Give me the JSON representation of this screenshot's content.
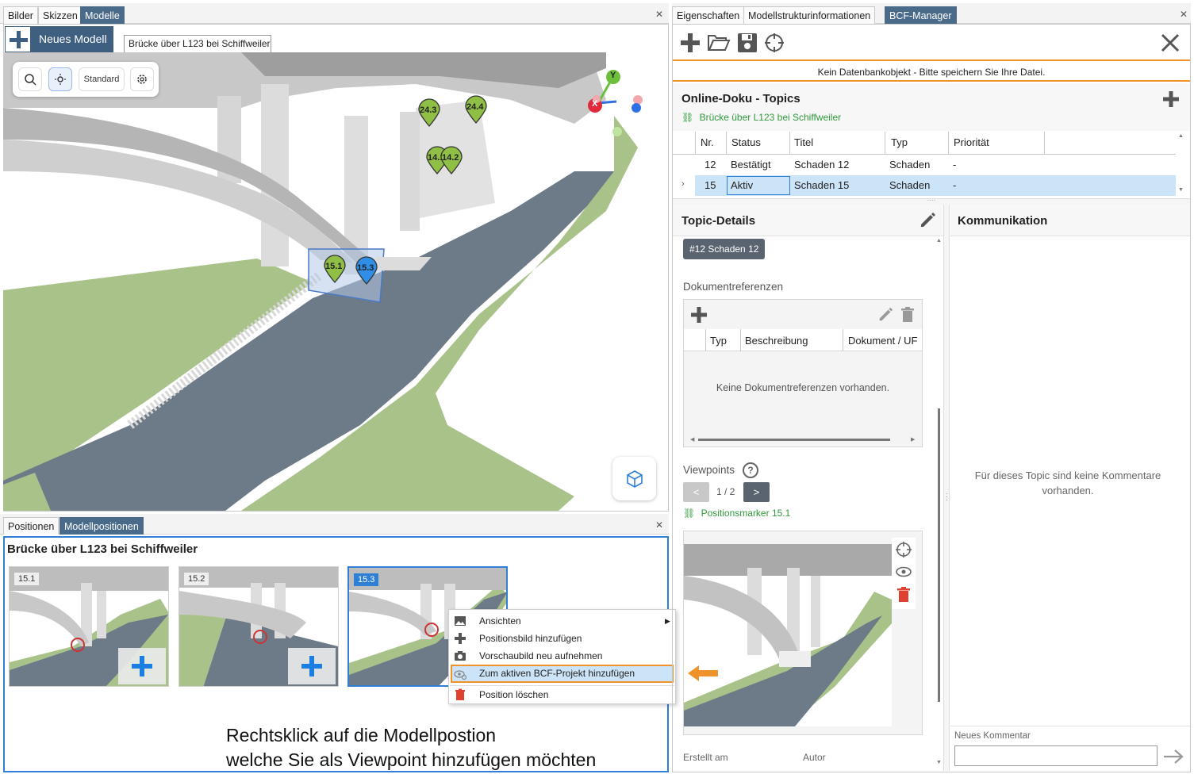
{
  "left_tabs": [
    "Bilder",
    "Skizzen",
    "Modelle"
  ],
  "new_model_button": "Neues Modell",
  "model_tab": "Brücke über L123 bei Schiffweiler",
  "toolbar": {
    "standard_label": "Standard"
  },
  "markers": [
    "24.3",
    "24.4",
    "14.1",
    "14.2",
    "15.1",
    "15.3"
  ],
  "axis_labels": {
    "y": "Y",
    "x": "X"
  },
  "bottom_tabs": [
    "Positionen",
    "Modellpositionen"
  ],
  "positions_title": "Brücke über L123 bei Schiffweiler",
  "thumbnails": [
    "15.1",
    "15.2",
    "15.3"
  ],
  "context_menu": {
    "items": [
      "Ansichten",
      "Positionsbild hinzufügen",
      "Vorschaubild neu aufnehmen",
      "Zum aktiven BCF-Projekt hinzufügen",
      "Position löschen"
    ]
  },
  "instruction": [
    "Rechtsklick auf die Modellpostion",
    "welche Sie als Viewpoint hinzufügen möchten"
  ],
  "right_tabs": [
    "Eigenschaften",
    "Modellstrukturinformationen",
    "BCF-Manager"
  ],
  "info_bar": "Kein Datenbankobjekt - Bitte speichern Sie Ihre Datei.",
  "topics": {
    "title": "Online-Doku - Topics",
    "subtitle": "Brücke über L123 bei Schiffweiler",
    "columns": [
      "Nr.",
      "Status",
      "Titel",
      "Typ",
      "Priorität"
    ],
    "rows": [
      {
        "nr": "12",
        "status": "Bestätigt",
        "titel": "Schaden 12",
        "typ": "Schaden",
        "prio": "-"
      },
      {
        "nr": "15",
        "status": "Aktiv",
        "titel": "Schaden 15",
        "typ": "Schaden",
        "prio": "-"
      }
    ]
  },
  "details": {
    "title": "Topic-Details",
    "badge": "#12 Schaden 12",
    "doc_refs_label": "Dokumentreferenzen",
    "doc_columns": [
      "Typ",
      "Beschreibung",
      "Dokument / UF"
    ],
    "doc_empty": "Keine Dokumentreferenzen vorhanden.",
    "viewpoints_label": "Viewpoints",
    "pager": "1 / 2",
    "prev": "<",
    "next": ">",
    "viewpoint_link": "Positionsmarker 15.1",
    "created_label": "Erstellt am",
    "author_label": "Autor"
  },
  "communication": {
    "title": "Kommunikation",
    "empty": "Für dieses Topic sind keine Kommentare vorhanden.",
    "new_comment_label": "Neues Kommentar"
  },
  "colors": {
    "tab_active": "#4a6a8a",
    "accent_orange": "#f0922a",
    "blue_plus": "#1a7fe0",
    "marker_green": "#8fbf45",
    "marker_blue": "#2f8fe6",
    "selected_row": "#cce4f7"
  }
}
